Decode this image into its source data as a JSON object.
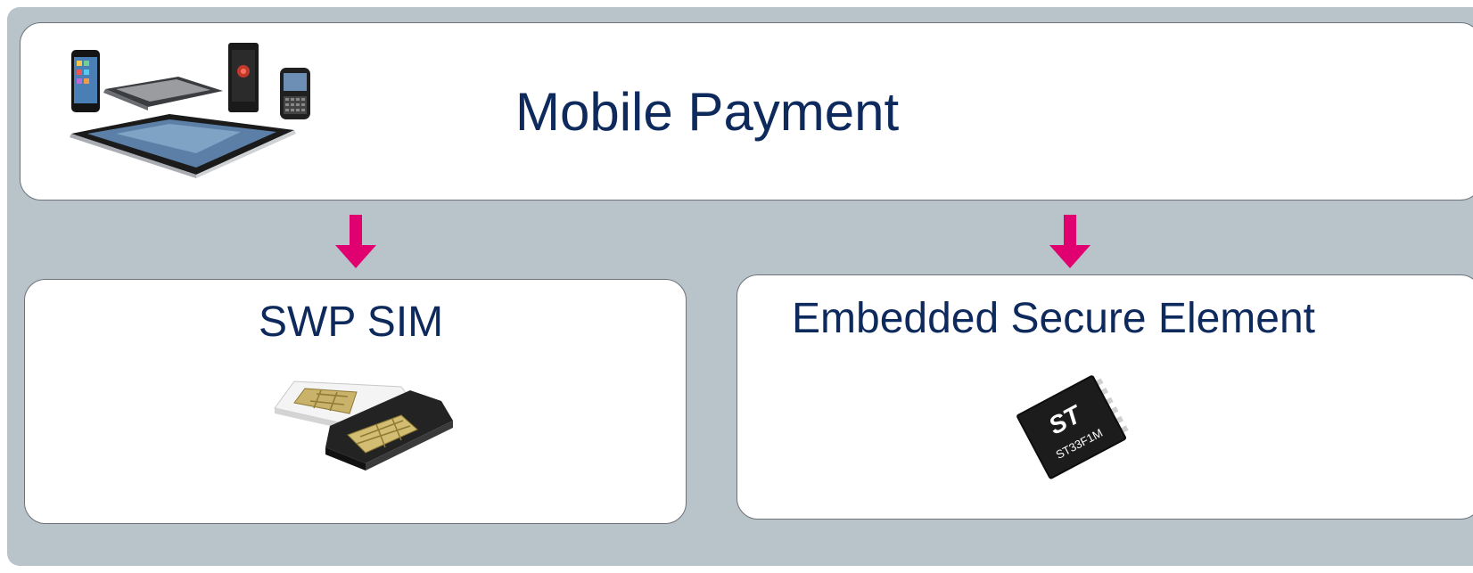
{
  "diagram": {
    "top_box": {
      "title": "Mobile Payment"
    },
    "left_box": {
      "title": "SWP SIM"
    },
    "right_box": {
      "title": "Embedded Secure Element",
      "chip_logo": "ST",
      "chip_label": "ST33F1M"
    }
  },
  "colors": {
    "background": "#b8c3ca",
    "title_text": "#0e2a5c",
    "arrow": "#e0006f",
    "box_fill": "#ffffff"
  },
  "icons": {
    "devices": "mobile-devices-icon",
    "sim": "sim-cards-icon",
    "chip": "secure-element-chip-icon",
    "arrow": "arrow-down-icon"
  }
}
